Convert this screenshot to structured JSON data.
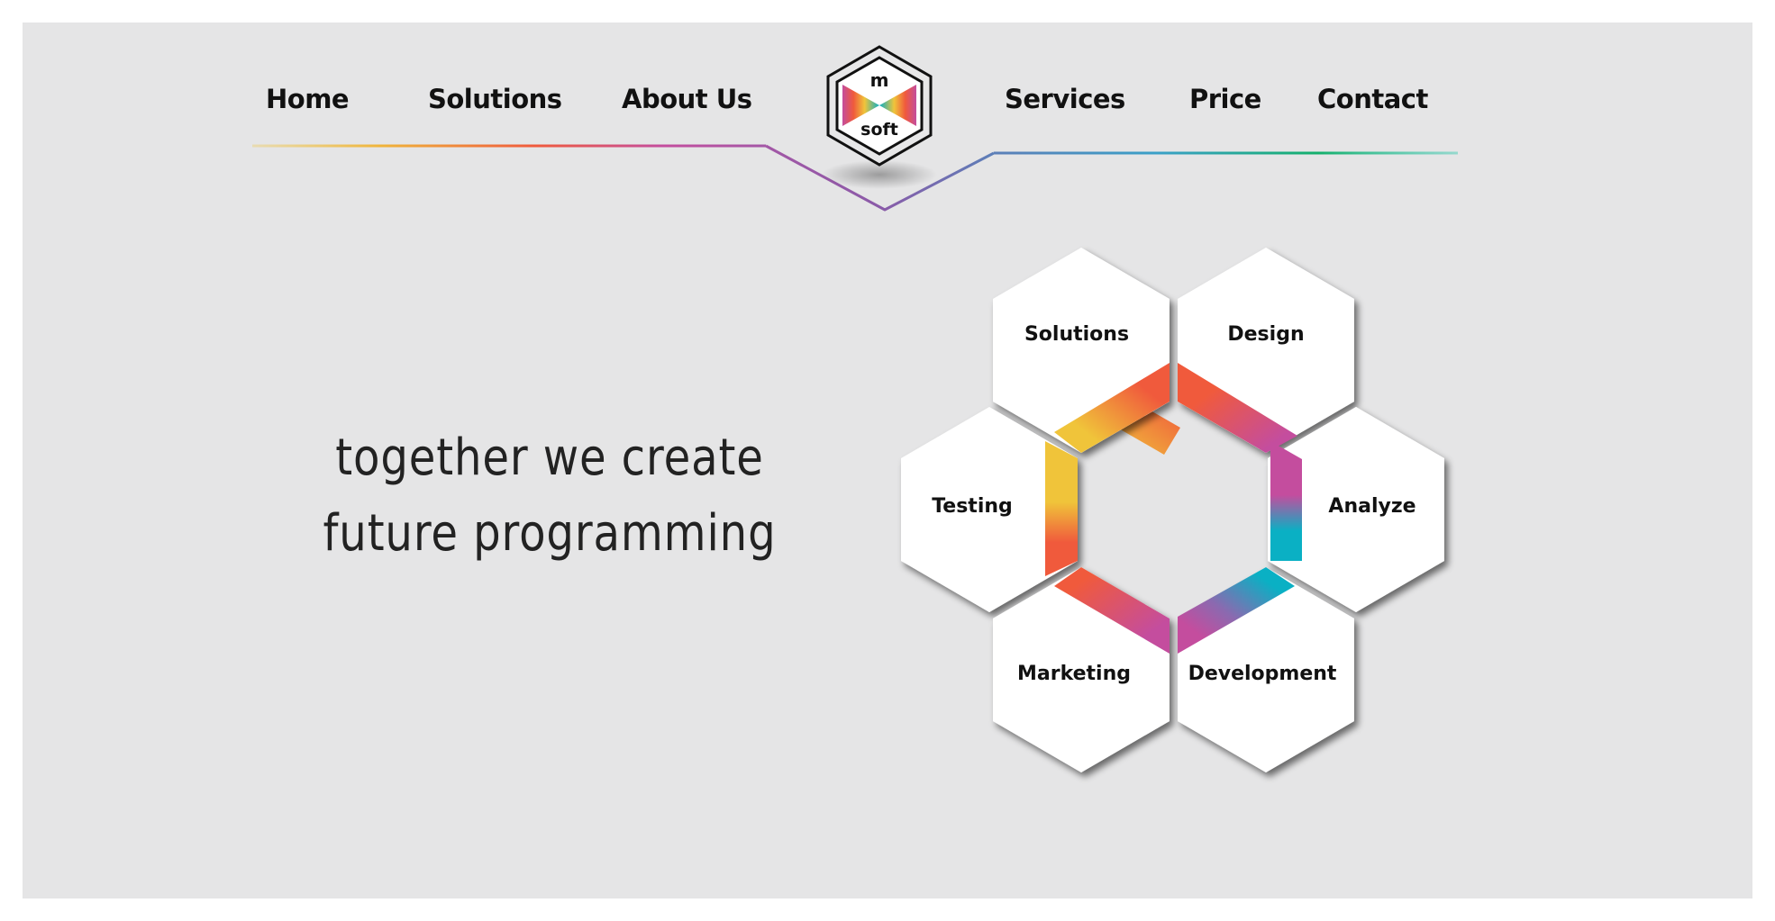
{
  "nav": {
    "left": [
      "Home",
      "Solutions",
      "About Us"
    ],
    "right": [
      "Services",
      "Price",
      "Contact"
    ]
  },
  "logo": {
    "top": "m",
    "bottom": "soft"
  },
  "hero": {
    "line1": "together we create",
    "line2": "future programming"
  },
  "hexagons": {
    "solutions": "Solutions",
    "design": "Design",
    "analyze": "Analyze",
    "development": "Development",
    "marketing": "Marketing",
    "testing": "Testing"
  },
  "colors": {
    "background": "#e5e5e6",
    "yellow": "#f0c43a",
    "orange": "#f05a3c",
    "magenta": "#c44d9e",
    "teal": "#0ab0c4",
    "blue": "#4a8fc0",
    "green": "#14b06c",
    "purple": "#8a5aa8"
  }
}
